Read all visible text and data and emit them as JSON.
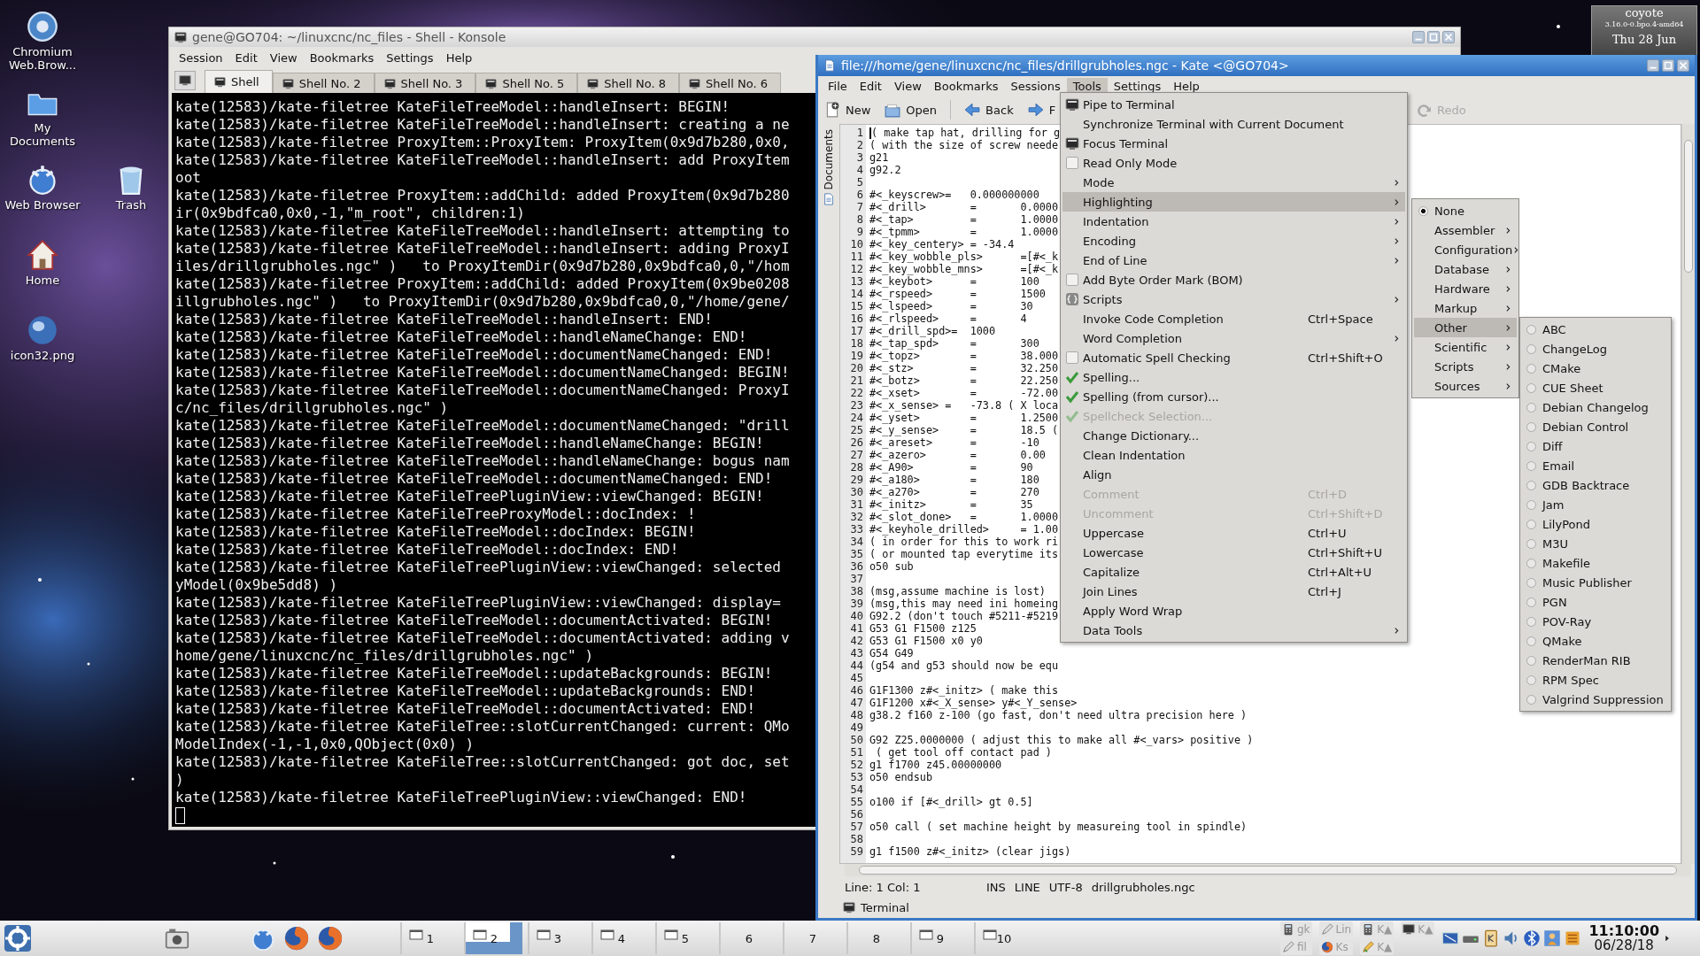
{
  "desktop": {
    "icons": [
      {
        "label": "Chromium Web.Brow...",
        "kind": "chromium"
      },
      {
        "label": "My Documents",
        "kind": "documents"
      },
      {
        "label": "Web Browser",
        "kind": "browser"
      },
      {
        "label": "Trash",
        "kind": "trash"
      },
      {
        "label": "Home",
        "kind": "home"
      },
      {
        "label": "icon32.png"
      }
    ],
    "widget": {
      "host": "coyote",
      "kernel": "3.16.0-0.bpo.4-amd64",
      "date": "Thu 28 Jun"
    }
  },
  "konsole": {
    "title": "gene@GO704: ~/linuxcnc/nc_files - Shell - Konsole",
    "menu": [
      "Session",
      "Edit",
      "View",
      "Bookmarks",
      "Settings",
      "Help"
    ],
    "tabs": [
      {
        "label": "Shell",
        "selected": true
      },
      {
        "label": "Shell No. 2",
        "selected": false
      },
      {
        "label": "Shell No. 3",
        "selected": false
      },
      {
        "label": "Shell No. 5",
        "selected": false
      },
      {
        "label": "Shell No. 8",
        "selected": false
      },
      {
        "label": "Shell No. 6",
        "selected": false
      }
    ],
    "lines": [
      "kate(12583)/kate-filetree KateFileTreeModel::handleInsert: BEGIN!",
      "kate(12583)/kate-filetree KateFileTreeModel::handleInsert: creating a ne",
      "kate(12583)/kate-filetree ProxyItem::ProxyItem: ProxyItem(0x9d7b280,0x0,",
      "kate(12583)/kate-filetree KateFileTreeModel::handleInsert: add ProxyItem",
      "oot",
      "kate(12583)/kate-filetree ProxyItem::addChild: added ProxyItem(0x9d7b280",
      "ir(0x9bdfca0,0x0,-1,\"m_root\", children:1)",
      "kate(12583)/kate-filetree KateFileTreeModel::handleInsert: attempting to",
      "kate(12583)/kate-filetree KateFileTreeModel::handleInsert: adding ProxyI",
      "iles/drillgrubholes.ngc\" )   to ProxyItemDir(0x9d7b280,0x9bdfca0,0,\"/hom",
      "kate(12583)/kate-filetree ProxyItem::addChild: added ProxyItem(0x9be0208",
      "illgrubholes.ngc\" )   to ProxyItemDir(0x9d7b280,0x9bdfca0,0,\"/home/gene/",
      "kate(12583)/kate-filetree KateFileTreeModel::handleInsert: END!",
      "kate(12583)/kate-filetree KateFileTreeModel::handleNameChange: END!",
      "kate(12583)/kate-filetree KateFileTreeModel::documentNameChanged: END!",
      "kate(12583)/kate-filetree KateFileTreeModel::documentNameChanged: BEGIN!",
      "kate(12583)/kate-filetree KateFileTreeModel::documentNameChanged: ProxyI",
      "c/nc_files/drillgrubholes.ngc\" )",
      "kate(12583)/kate-filetree KateFileTreeModel::documentNameChanged: \"drill",
      "kate(12583)/kate-filetree KateFileTreeModel::handleNameChange: BEGIN!",
      "kate(12583)/kate-filetree KateFileTreeModel::handleNameChange: bogus nam",
      "kate(12583)/kate-filetree KateFileTreeModel::documentNameChanged: END!",
      "kate(12583)/kate-filetree KateFileTreePluginView::viewChanged: BEGIN!",
      "kate(12583)/kate-filetree KateFileTreeProxyModel::docIndex: !",
      "kate(12583)/kate-filetree KateFileTreeModel::docIndex: BEGIN!",
      "kate(12583)/kate-filetree KateFileTreeModel::docIndex: END!",
      "kate(12583)/kate-filetree KateFileTreePluginView::viewChanged: selected",
      "yModel(0x9be5dd8) )",
      "kate(12583)/kate-filetree KateFileTreePluginView::viewChanged: display=",
      "kate(12583)/kate-filetree KateFileTreeModel::documentActivated: BEGIN!",
      "kate(12583)/kate-filetree KateFileTreeModel::documentActivated: adding v",
      "home/gene/linuxcnc/nc_files/drillgrubholes.ngc\" )",
      "kate(12583)/kate-filetree KateFileTreeModel::updateBackgrounds: BEGIN!",
      "kate(12583)/kate-filetree KateFileTreeModel::updateBackgrounds: END!",
      "kate(12583)/kate-filetree KateFileTreeModel::documentActivated: END!",
      "kate(12583)/kate-filetree KateFileTree::slotCurrentChanged: current: QMo",
      "ModelIndex(-1,-1,0x0,QObject(0x0) )",
      "kate(12583)/kate-filetree KateFileTree::slotCurrentChanged: got doc, set",
      ")",
      "kate(12583)/kate-filetree KateFileTreePluginView::viewChanged: END!"
    ]
  },
  "kate": {
    "title": "file:///home/gene/linuxcnc/nc_files/drillgrubholes.ngc - Kate <@GO704>",
    "menu": [
      {
        "label": "File",
        "selected": false
      },
      {
        "label": "Edit",
        "selected": false
      },
      {
        "label": "View",
        "selected": false
      },
      {
        "label": "Bookmarks",
        "selected": false
      },
      {
        "label": "Sessions",
        "selected": false
      },
      {
        "label": "Tools",
        "selected": true
      },
      {
        "label": "Settings",
        "selected": false
      },
      {
        "label": "Help",
        "selected": false
      }
    ],
    "toolbar": [
      {
        "label": "New",
        "kind": "new",
        "disabled": false
      },
      {
        "label": "Open",
        "kind": "open",
        "disabled": false
      },
      {
        "label": "Back",
        "kind": "back",
        "disabled": false
      },
      {
        "label": "F",
        "kind": "forward",
        "disabled": false
      },
      {
        "label": "Redo",
        "kind": "redo",
        "disabled": true
      }
    ],
    "side_tab": "Documents",
    "lines": [
      {
        "n": "1",
        "text": "( make tap hat, drilling for g",
        "cursor": true
      },
      {
        "n": "2",
        "text": "( with the size of screw neede",
        "cursor": false
      },
      {
        "n": "3",
        "text": "g21",
        "cursor": false
      },
      {
        "n": "4",
        "text": "g92.2",
        "cursor": false
      },
      {
        "n": "5",
        "cursor": false
      },
      {
        "n": "6",
        "text": "#<_keyscrew>=   0.000000000",
        "cursor": false
      },
      {
        "n": "7",
        "text": "#<_drill>       =       0.0000",
        "cursor": false
      },
      {
        "n": "8",
        "text": "#<_tap>         =       1.0000",
        "cursor": false
      },
      {
        "n": "9",
        "text": "#<_tpmm>        =       1.0000",
        "cursor": false
      },
      {
        "n": "10",
        "text": "#<_key_centery> = -34.4",
        "cursor": false
      },
      {
        "n": "11",
        "text": "#<_key_wobble_pls>      =[#<_k",
        "cursor": false
      },
      {
        "n": "12",
        "text": "#<_key_wobble_mns>      =[#<_k",
        "cursor": false
      },
      {
        "n": "13",
        "text": "#<_keybot>      =       100",
        "cursor": false
      },
      {
        "n": "14",
        "text": "#<_rspeed>      =       1500",
        "cursor": false
      },
      {
        "n": "15",
        "text": "#<_lspeed>      =       30",
        "cursor": false
      },
      {
        "n": "16",
        "text": "#<_rlspeed>     =       4",
        "cursor": false
      },
      {
        "n": "17",
        "text": "#<_drill_spd>=  1000",
        "cursor": false
      },
      {
        "n": "18",
        "text": "#<_tap_spd>     =       300",
        "cursor": false
      },
      {
        "n": "19",
        "text": "#<_topz>        =       38.000",
        "cursor": false
      },
      {
        "n": "20",
        "text": "#<_stz>         =       32.250",
        "cursor": false
      },
      {
        "n": "21",
        "text": "#<_botz>        =       22.250",
        "cursor": false
      },
      {
        "n": "22",
        "text": "#<_xset>        =       -72.00",
        "cursor": false
      },
      {
        "n": "23",
        "text": "#<_x_sense> =   -73.8 ( X loca",
        "cursor": false
      },
      {
        "n": "24",
        "text": "#<_yset>        =       1.2500",
        "cursor": false
      },
      {
        "n": "25",
        "text": "#<_y_sense>     =       18.5 (",
        "cursor": false
      },
      {
        "n": "26",
        "text": "#<_areset>      =       -10",
        "cursor": false
      },
      {
        "n": "27",
        "text": "#<_azero>       =       0.00",
        "cursor": false
      },
      {
        "n": "28",
        "text": "#<_A90>         =       90",
        "cursor": false
      },
      {
        "n": "29",
        "text": "#<_a180>        =       180",
        "cursor": false
      },
      {
        "n": "30",
        "text": "#<_a270>        =       270",
        "cursor": false
      },
      {
        "n": "31",
        "text": "#<_initz>       =       35",
        "cursor": false
      },
      {
        "n": "32",
        "text": "#<_slot_done>   =       1.0000",
        "cursor": false
      },
      {
        "n": "33",
        "text": "#<_keyhole_drilled>     = 1.00",
        "cursor": false
      },
      {
        "n": "34",
        "text": "( in order for this to work ri",
        "cursor": false
      },
      {
        "n": "35",
        "text": "( or mounted tap everytime its",
        "cursor": false
      },
      {
        "n": "36",
        "text": "o50 sub",
        "cursor": false
      },
      {
        "n": "37",
        "cursor": false
      },
      {
        "n": "38",
        "text": "(msg,assume machine is lost)",
        "cursor": false
      },
      {
        "n": "39",
        "text": "(msg,this may need ini homeing",
        "cursor": false
      },
      {
        "n": "40",
        "text": "G92.2 (don't touch #5211-#5219",
        "cursor": false
      },
      {
        "n": "41",
        "text": "G53 G1 F1500 z125",
        "cursor": false
      },
      {
        "n": "42",
        "text": "G53 G1 F1500 x0 y0",
        "cursor": false
      },
      {
        "n": "43",
        "text": "G54 G49",
        "cursor": false
      },
      {
        "n": "44",
        "text": "(g54 and g53 should now be equ",
        "cursor": false
      },
      {
        "n": "45",
        "cursor": false
      },
      {
        "n": "46",
        "text": "G1F1300 z#<_initz> ( make this",
        "cursor": false
      },
      {
        "n": "47",
        "text": "G1F1200 x#<_X_sense> y#<_Y_sense>",
        "cursor": false
      },
      {
        "n": "48",
        "text": "g38.2 f160 z-100 (go fast, don't need ultra precision here )",
        "cursor": false
      },
      {
        "n": "49",
        "cursor": false
      },
      {
        "n": "50",
        "text": "G92 Z25.0000000 ( adjust this to make all #<_vars> positive )",
        "cursor": false
      },
      {
        "n": "51",
        "text": " ( get tool off contact pad )",
        "cursor": false
      },
      {
        "n": "52",
        "text": "g1 f1700 z45.00000000",
        "cursor": false
      },
      {
        "n": "53",
        "text": "o50 endsub",
        "cursor": false
      },
      {
        "n": "54",
        "cursor": false
      },
      {
        "n": "55",
        "text": "o100 if [#<_drill> gt 0.5]",
        "cursor": false
      },
      {
        "n": "56",
        "cursor": false
      },
      {
        "n": "57",
        "text": "o50 call ( set machine height by measureing tool in spindle)",
        "cursor": false
      },
      {
        "n": "58",
        "cursor": false
      },
      {
        "n": "59",
        "text": "g1 f1500 z#<_initz> (clear jigs)",
        "cursor": false
      }
    ],
    "status": {
      "position": "Line: 1 Col: 1",
      "mode": "INS",
      "selection": "LINE",
      "encoding": "UTF-8",
      "file": "drillgrubholes.ngc"
    },
    "bottom_tab": "Terminal"
  },
  "tools_menu": {
    "groups": [
      [
        {
          "label": "Pipe to Terminal",
          "kind": "terminal",
          "submenu": false,
          "disabled": false,
          "selected": false
        },
        {
          "label": "Synchronize Terminal with Current Document",
          "kind": "plain",
          "submenu": false,
          "disabled": false,
          "selected": false
        },
        {
          "label": "Focus Terminal",
          "kind": "terminal",
          "submenu": false,
          "disabled": false,
          "selected": false
        },
        {
          "label": "Read Only Mode",
          "kind": "check",
          "checked": false,
          "submenu": false,
          "disabled": false,
          "selected": false
        }
      ],
      [
        {
          "label": "Mode",
          "kind": "plain",
          "submenu": true,
          "disabled": false,
          "selected": false
        },
        {
          "label": "Highlighting",
          "kind": "plain",
          "submenu": true,
          "disabled": false,
          "selected": true
        },
        {
          "label": "Indentation",
          "kind": "plain",
          "submenu": true,
          "disabled": false,
          "selected": false
        },
        {
          "label": "Encoding",
          "kind": "plain",
          "submenu": true,
          "disabled": false,
          "selected": false
        },
        {
          "label": "End of Line",
          "kind": "plain",
          "submenu": true,
          "disabled": false,
          "selected": false
        },
        {
          "label": "Add Byte Order Mark (BOM)",
          "kind": "check",
          "checked": false,
          "submenu": false,
          "disabled": false,
          "selected": false
        }
      ],
      [
        {
          "label": "Scripts",
          "kind": "scripts",
          "submenu": true,
          "disabled": false,
          "selected": false
        }
      ],
      [
        {
          "label": "Invoke Code Completion",
          "kind": "plain",
          "shortcut": "Ctrl+Space",
          "submenu": false,
          "disabled": false,
          "selected": false
        },
        {
          "label": "Word Completion",
          "kind": "plain",
          "submenu": true,
          "disabled": false,
          "selected": false
        }
      ],
      [
        {
          "label": "Automatic Spell Checking",
          "kind": "check",
          "checked": false,
          "shortcut": "Ctrl+Shift+O",
          "submenu": false,
          "disabled": false,
          "selected": false
        },
        {
          "label": "Spelling...",
          "kind": "spell",
          "submenu": false,
          "disabled": false,
          "selected": false
        },
        {
          "label": "Spelling (from cursor)...",
          "kind": "spell",
          "submenu": false,
          "disabled": false,
          "selected": false
        },
        {
          "label": "Spellcheck Selection...",
          "kind": "spell",
          "submenu": false,
          "disabled": true,
          "selected": false
        },
        {
          "label": "Change Dictionary...",
          "kind": "plain",
          "submenu": false,
          "disabled": false,
          "selected": false
        }
      ],
      [
        {
          "label": "Clean Indentation",
          "kind": "plain",
          "submenu": false,
          "disabled": false,
          "selected": false
        },
        {
          "label": "Align",
          "kind": "plain",
          "submenu": false,
          "disabled": false,
          "selected": false
        }
      ],
      [
        {
          "label": "Comment",
          "kind": "plain",
          "shortcut": "Ctrl+D",
          "submenu": false,
          "disabled": true,
          "selected": false
        },
        {
          "label": "Uncomment",
          "kind": "plain",
          "shortcut": "Ctrl+Shift+D",
          "submenu": false,
          "disabled": true,
          "selected": false
        }
      ],
      [
        {
          "label": "Uppercase",
          "kind": "plain",
          "shortcut": "Ctrl+U",
          "submenu": false,
          "disabled": false,
          "selected": false
        },
        {
          "label": "Lowercase",
          "kind": "plain",
          "shortcut": "Ctrl+Shift+U",
          "submenu": false,
          "disabled": false,
          "selected": false
        },
        {
          "label": "Capitalize",
          "kind": "plain",
          "shortcut": "Ctrl+Alt+U",
          "submenu": false,
          "disabled": false,
          "selected": false
        }
      ],
      [
        {
          "label": "Join Lines",
          "kind": "plain",
          "shortcut": "Ctrl+J",
          "submenu": false,
          "disabled": false,
          "selected": false
        },
        {
          "label": "Apply Word Wrap",
          "kind": "plain",
          "submenu": false,
          "disabled": false,
          "selected": false
        }
      ],
      [
        {
          "label": "Data Tools",
          "kind": "plain",
          "submenu": true,
          "disabled": false,
          "selected": false
        }
      ]
    ]
  },
  "highlighting_menu": {
    "items": [
      {
        "label": "None",
        "kind": "radio",
        "checked": true,
        "selected": false
      },
      {
        "label": "Assembler",
        "kind": "submenu",
        "selected": false
      },
      {
        "label": "Configuration",
        "kind": "submenu",
        "selected": false
      },
      {
        "label": "Database",
        "kind": "submenu",
        "selected": false
      },
      {
        "label": "Hardware",
        "kind": "submenu",
        "selected": false
      },
      {
        "label": "Markup",
        "kind": "submenu",
        "selected": false
      },
      {
        "label": "Other",
        "kind": "submenu",
        "selected": true
      },
      {
        "label": "Scientific",
        "kind": "submenu",
        "selected": false
      },
      {
        "label": "Scripts",
        "kind": "submenu",
        "selected": false
      },
      {
        "label": "Sources",
        "kind": "submenu",
        "selected": false
      }
    ]
  },
  "other_menu": {
    "items": [
      {
        "label": "ABC",
        "checked": false
      },
      {
        "label": "ChangeLog",
        "checked": false
      },
      {
        "label": "CMake",
        "checked": false
      },
      {
        "label": "CUE Sheet",
        "checked": false
      },
      {
        "label": "Debian Changelog",
        "checked": false
      },
      {
        "label": "Debian Control",
        "checked": false
      },
      {
        "label": "Diff",
        "checked": false
      },
      {
        "label": "Email",
        "checked": false
      },
      {
        "label": "GDB Backtrace",
        "checked": false
      },
      {
        "label": "Jam",
        "checked": false
      },
      {
        "label": "LilyPond",
        "checked": false
      },
      {
        "label": "M3U",
        "checked": false
      },
      {
        "label": "Makefile",
        "checked": false
      },
      {
        "label": "Music Publisher",
        "checked": false
      },
      {
        "label": "PGN",
        "checked": false
      },
      {
        "label": "POV-Ray",
        "checked": false
      },
      {
        "label": "QMake",
        "checked": false
      },
      {
        "label": "RenderMan RIB",
        "checked": false
      },
      {
        "label": "RPM Spec",
        "checked": false
      },
      {
        "label": "Valgrind Suppression",
        "checked": false
      }
    ]
  },
  "taskbar": {
    "pager": [
      {
        "label": "1",
        "selected": false,
        "windows": true
      },
      {
        "label": "2",
        "selected": true,
        "windows": true
      },
      {
        "label": "3",
        "selected": false,
        "windows": true
      },
      {
        "label": "4",
        "selected": false,
        "windows": true
      },
      {
        "label": "5",
        "selected": false,
        "windows": true
      },
      {
        "label": "6",
        "selected": false,
        "windows": false
      },
      {
        "label": "7",
        "selected": false,
        "windows": false
      },
      {
        "label": "8",
        "selected": false,
        "windows": false
      },
      {
        "label": "9",
        "selected": false,
        "windows": true
      },
      {
        "label": "10",
        "selected": false,
        "windows": true
      }
    ],
    "tasks": [
      {
        "label": "gk"
      },
      {
        "label": "Lin"
      },
      {
        "label": "K▲"
      },
      {
        "label": "K▲"
      },
      {
        "label": "fil"
      },
      {
        "label": "Ks"
      },
      {
        "label": "K▲"
      }
    ],
    "clock": {
      "time": "11:10:00",
      "date": "06/28/18"
    }
  }
}
